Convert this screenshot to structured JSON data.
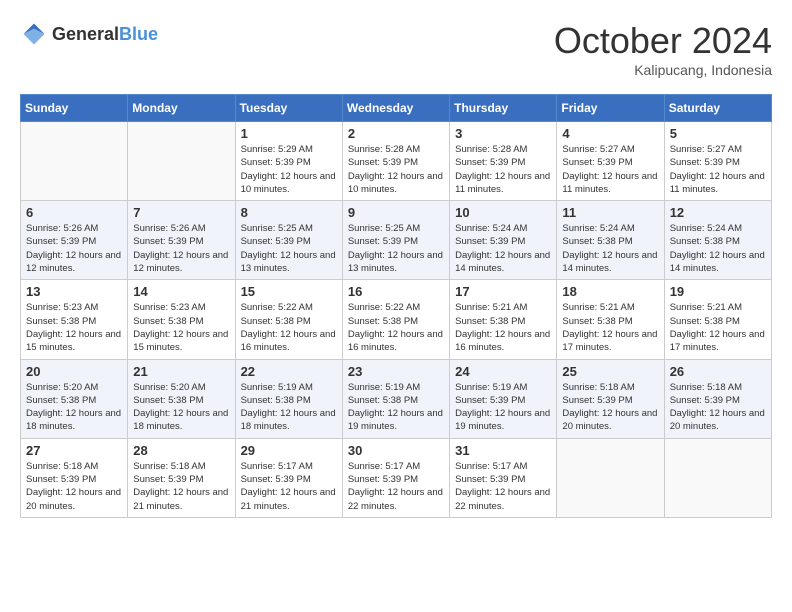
{
  "logo": {
    "general": "General",
    "blue": "Blue"
  },
  "header": {
    "month": "October 2024",
    "location": "Kalipucang, Indonesia"
  },
  "days_of_week": [
    "Sunday",
    "Monday",
    "Tuesday",
    "Wednesday",
    "Thursday",
    "Friday",
    "Saturday"
  ],
  "weeks": [
    [
      {
        "day": "",
        "sunrise": "",
        "sunset": "",
        "daylight": ""
      },
      {
        "day": "",
        "sunrise": "",
        "sunset": "",
        "daylight": ""
      },
      {
        "day": "1",
        "sunrise": "Sunrise: 5:29 AM",
        "sunset": "Sunset: 5:39 PM",
        "daylight": "Daylight: 12 hours and 10 minutes."
      },
      {
        "day": "2",
        "sunrise": "Sunrise: 5:28 AM",
        "sunset": "Sunset: 5:39 PM",
        "daylight": "Daylight: 12 hours and 10 minutes."
      },
      {
        "day": "3",
        "sunrise": "Sunrise: 5:28 AM",
        "sunset": "Sunset: 5:39 PM",
        "daylight": "Daylight: 12 hours and 11 minutes."
      },
      {
        "day": "4",
        "sunrise": "Sunrise: 5:27 AM",
        "sunset": "Sunset: 5:39 PM",
        "daylight": "Daylight: 12 hours and 11 minutes."
      },
      {
        "day": "5",
        "sunrise": "Sunrise: 5:27 AM",
        "sunset": "Sunset: 5:39 PM",
        "daylight": "Daylight: 12 hours and 11 minutes."
      }
    ],
    [
      {
        "day": "6",
        "sunrise": "Sunrise: 5:26 AM",
        "sunset": "Sunset: 5:39 PM",
        "daylight": "Daylight: 12 hours and 12 minutes."
      },
      {
        "day": "7",
        "sunrise": "Sunrise: 5:26 AM",
        "sunset": "Sunset: 5:39 PM",
        "daylight": "Daylight: 12 hours and 12 minutes."
      },
      {
        "day": "8",
        "sunrise": "Sunrise: 5:25 AM",
        "sunset": "Sunset: 5:39 PM",
        "daylight": "Daylight: 12 hours and 13 minutes."
      },
      {
        "day": "9",
        "sunrise": "Sunrise: 5:25 AM",
        "sunset": "Sunset: 5:39 PM",
        "daylight": "Daylight: 12 hours and 13 minutes."
      },
      {
        "day": "10",
        "sunrise": "Sunrise: 5:24 AM",
        "sunset": "Sunset: 5:39 PM",
        "daylight": "Daylight: 12 hours and 14 minutes."
      },
      {
        "day": "11",
        "sunrise": "Sunrise: 5:24 AM",
        "sunset": "Sunset: 5:38 PM",
        "daylight": "Daylight: 12 hours and 14 minutes."
      },
      {
        "day": "12",
        "sunrise": "Sunrise: 5:24 AM",
        "sunset": "Sunset: 5:38 PM",
        "daylight": "Daylight: 12 hours and 14 minutes."
      }
    ],
    [
      {
        "day": "13",
        "sunrise": "Sunrise: 5:23 AM",
        "sunset": "Sunset: 5:38 PM",
        "daylight": "Daylight: 12 hours and 15 minutes."
      },
      {
        "day": "14",
        "sunrise": "Sunrise: 5:23 AM",
        "sunset": "Sunset: 5:38 PM",
        "daylight": "Daylight: 12 hours and 15 minutes."
      },
      {
        "day": "15",
        "sunrise": "Sunrise: 5:22 AM",
        "sunset": "Sunset: 5:38 PM",
        "daylight": "Daylight: 12 hours and 16 minutes."
      },
      {
        "day": "16",
        "sunrise": "Sunrise: 5:22 AM",
        "sunset": "Sunset: 5:38 PM",
        "daylight": "Daylight: 12 hours and 16 minutes."
      },
      {
        "day": "17",
        "sunrise": "Sunrise: 5:21 AM",
        "sunset": "Sunset: 5:38 PM",
        "daylight": "Daylight: 12 hours and 16 minutes."
      },
      {
        "day": "18",
        "sunrise": "Sunrise: 5:21 AM",
        "sunset": "Sunset: 5:38 PM",
        "daylight": "Daylight: 12 hours and 17 minutes."
      },
      {
        "day": "19",
        "sunrise": "Sunrise: 5:21 AM",
        "sunset": "Sunset: 5:38 PM",
        "daylight": "Daylight: 12 hours and 17 minutes."
      }
    ],
    [
      {
        "day": "20",
        "sunrise": "Sunrise: 5:20 AM",
        "sunset": "Sunset: 5:38 PM",
        "daylight": "Daylight: 12 hours and 18 minutes."
      },
      {
        "day": "21",
        "sunrise": "Sunrise: 5:20 AM",
        "sunset": "Sunset: 5:38 PM",
        "daylight": "Daylight: 12 hours and 18 minutes."
      },
      {
        "day": "22",
        "sunrise": "Sunrise: 5:19 AM",
        "sunset": "Sunset: 5:38 PM",
        "daylight": "Daylight: 12 hours and 18 minutes."
      },
      {
        "day": "23",
        "sunrise": "Sunrise: 5:19 AM",
        "sunset": "Sunset: 5:38 PM",
        "daylight": "Daylight: 12 hours and 19 minutes."
      },
      {
        "day": "24",
        "sunrise": "Sunrise: 5:19 AM",
        "sunset": "Sunset: 5:39 PM",
        "daylight": "Daylight: 12 hours and 19 minutes."
      },
      {
        "day": "25",
        "sunrise": "Sunrise: 5:18 AM",
        "sunset": "Sunset: 5:39 PM",
        "daylight": "Daylight: 12 hours and 20 minutes."
      },
      {
        "day": "26",
        "sunrise": "Sunrise: 5:18 AM",
        "sunset": "Sunset: 5:39 PM",
        "daylight": "Daylight: 12 hours and 20 minutes."
      }
    ],
    [
      {
        "day": "27",
        "sunrise": "Sunrise: 5:18 AM",
        "sunset": "Sunset: 5:39 PM",
        "daylight": "Daylight: 12 hours and 20 minutes."
      },
      {
        "day": "28",
        "sunrise": "Sunrise: 5:18 AM",
        "sunset": "Sunset: 5:39 PM",
        "daylight": "Daylight: 12 hours and 21 minutes."
      },
      {
        "day": "29",
        "sunrise": "Sunrise: 5:17 AM",
        "sunset": "Sunset: 5:39 PM",
        "daylight": "Daylight: 12 hours and 21 minutes."
      },
      {
        "day": "30",
        "sunrise": "Sunrise: 5:17 AM",
        "sunset": "Sunset: 5:39 PM",
        "daylight": "Daylight: 12 hours and 22 minutes."
      },
      {
        "day": "31",
        "sunrise": "Sunrise: 5:17 AM",
        "sunset": "Sunset: 5:39 PM",
        "daylight": "Daylight: 12 hours and 22 minutes."
      },
      {
        "day": "",
        "sunrise": "",
        "sunset": "",
        "daylight": ""
      },
      {
        "day": "",
        "sunrise": "",
        "sunset": "",
        "daylight": ""
      }
    ]
  ]
}
